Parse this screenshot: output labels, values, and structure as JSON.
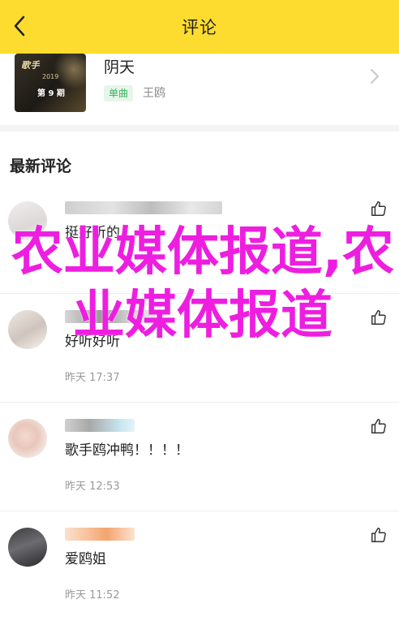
{
  "header": {
    "title": "评论"
  },
  "song": {
    "title": "阴天",
    "tag": "单曲",
    "artist": "王鸥",
    "cover_text": {
      "logo": "歌手",
      "year": "2019",
      "episode": "第 9 期"
    }
  },
  "comments": {
    "section_title": "最新评论",
    "items": [
      {
        "text": "挺好听的",
        "time": ""
      },
      {
        "text": "好听好听",
        "time": "昨天 17:37"
      },
      {
        "text": "歌手鸥冲鸭！！！！",
        "time": "昨天 12:53"
      },
      {
        "text": "爱鸥姐",
        "time": "昨天 11:52"
      }
    ]
  },
  "watermark": {
    "text": "农业媒体报道,农业媒体报道"
  },
  "colors": {
    "header_bg": "#fedc2f",
    "tag_bg": "#e6f6ea",
    "tag_text": "#3bb25a",
    "watermark": "#ee1ee0"
  }
}
